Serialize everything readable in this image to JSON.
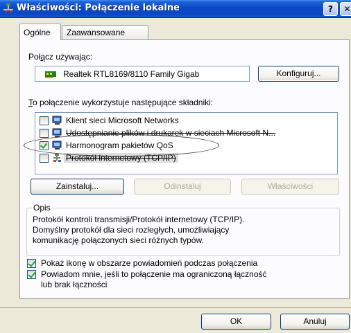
{
  "window": {
    "title": "Właściwości: Połączenie lokalne",
    "help_button": "?",
    "close_button": "✕"
  },
  "tabs": [
    {
      "label": "Ogólne",
      "active": true
    },
    {
      "label": "Zaawansowane",
      "active": false
    }
  ],
  "connect_using": {
    "label_pre": "Poł",
    "label_acc": "ą",
    "label_post": "cz używając:",
    "adapter": "Realtek RTL8169/8110 Family Gigab",
    "configure_button": "Konfiguruj..."
  },
  "components": {
    "label_acc": "T",
    "label_post": "o połączenie wykorzystuje następujące składniki:",
    "items": [
      {
        "label": "Klient sieci Microsoft Networks",
        "checked": false,
        "icon": "network-client-icon"
      },
      {
        "label": "Udostępnianie plików i drukarek w sieciach Microsoft N...",
        "checked": false,
        "icon": "network-service-icon"
      },
      {
        "label": "Harmonogram pakietów QoS",
        "checked": true,
        "icon": "network-service-icon"
      },
      {
        "label": "Protokół internetowy (TCP/IP)",
        "checked": false,
        "icon": "protocol-icon"
      }
    ]
  },
  "buttons": {
    "install": "Zainstaluj...",
    "uninstall": "Odinstaluj",
    "properties": "Właściwości",
    "ok": "OK",
    "cancel": "Anuluj"
  },
  "description": {
    "title": "Opis",
    "lines": [
      "Protokół kontroli transmisji/Protokół internetowy (TCP/IP).",
      "Domyślny protokół dla sieci rozległych, umożliwiający",
      "komunikację połączonych sieci różnych typów."
    ]
  },
  "options": [
    {
      "label": "Pokaż ikonę w obszarze powiadomień podczas połączenia",
      "checked": true
    },
    {
      "line1": "Powiadom mnie, jeśli to połączenie ma ograniczoną łączność",
      "line2": "lub brak łączności",
      "checked": true
    }
  ],
  "colors": {
    "titlebar": "#0a4ac8",
    "dialog_bg": "#ece9d8",
    "panel_bg": "#fcfcfe",
    "tab_highlight": "#ffc83c",
    "checkmark": "#21a121"
  }
}
